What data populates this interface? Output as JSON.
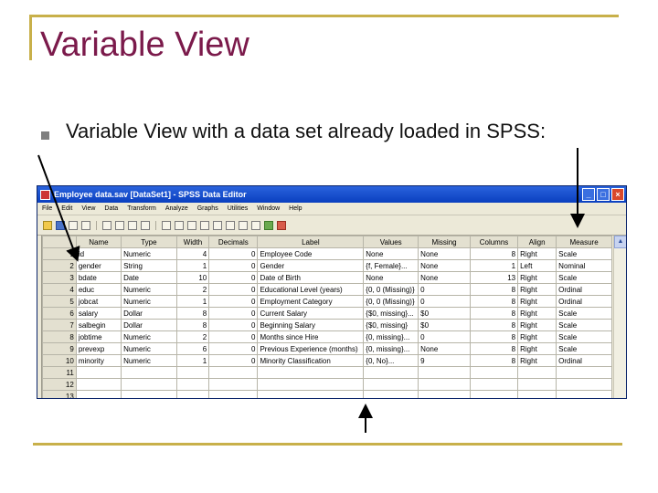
{
  "slide": {
    "title": "Variable View",
    "bullet": "Variable View with a data set already loaded in SPSS:"
  },
  "window": {
    "title": "Employee data.sav [DataSet1] - SPSS Data Editor",
    "controls": [
      "_",
      "□",
      "×"
    ],
    "menu": [
      "File",
      "Edit",
      "View",
      "Data",
      "Transform",
      "Analyze",
      "Graphs",
      "Utilities",
      "Window",
      "Help"
    ]
  },
  "grid": {
    "columns": [
      "",
      "Name",
      "Type",
      "Width",
      "Decimals",
      "Label",
      "Values",
      "Missing",
      "Columns",
      "Align",
      "Measure"
    ],
    "rows": [
      [
        "1",
        "id",
        "Numeric",
        "4",
        "0",
        "Employee Code",
        "None",
        "None",
        "8",
        "Right",
        "Scale"
      ],
      [
        "2",
        "gender",
        "String",
        "1",
        "0",
        "Gender",
        "{f, Female}...",
        "None",
        "1",
        "Left",
        "Nominal"
      ],
      [
        "3",
        "bdate",
        "Date",
        "10",
        "0",
        "Date of Birth",
        "None",
        "None",
        "13",
        "Right",
        "Scale"
      ],
      [
        "4",
        "educ",
        "Numeric",
        "2",
        "0",
        "Educational Level (years)",
        "{0, 0 (Missing)}",
        "0",
        "8",
        "Right",
        "Ordinal"
      ],
      [
        "5",
        "jobcat",
        "Numeric",
        "1",
        "0",
        "Employment Category",
        "{0, 0 (Missing)}",
        "0",
        "8",
        "Right",
        "Ordinal"
      ],
      [
        "6",
        "salary",
        "Dollar",
        "8",
        "0",
        "Current Salary",
        "{$0, missing}...",
        "$0",
        "8",
        "Right",
        "Scale"
      ],
      [
        "7",
        "salbegin",
        "Dollar",
        "8",
        "0",
        "Beginning Salary",
        "{$0, missing}",
        "$0",
        "8",
        "Right",
        "Scale"
      ],
      [
        "8",
        "jobtime",
        "Numeric",
        "2",
        "0",
        "Months since Hire",
        "{0, missing}...",
        "0",
        "8",
        "Right",
        "Scale"
      ],
      [
        "9",
        "prevexp",
        "Numeric",
        "6",
        "0",
        "Previous Experience (months)",
        "{0, missing}...",
        "None",
        "8",
        "Right",
        "Scale"
      ],
      [
        "10",
        "minority",
        "Numeric",
        "1",
        "0",
        "Minority Classification",
        "{0, No}...",
        "9",
        "8",
        "Right",
        "Ordinal"
      ],
      [
        "11",
        "",
        "",
        "",
        "",
        "",
        "",
        "",
        "",
        "",
        ""
      ],
      [
        "12",
        "",
        "",
        "",
        "",
        "",
        "",
        "",
        "",
        "",
        ""
      ],
      [
        "13",
        "",
        "",
        "",
        "",
        "",
        "",
        "",
        "",
        "",
        ""
      ]
    ]
  },
  "colors": {
    "title": "#7b1a4b",
    "frame": "#c8b04a",
    "titlebar": "#0a3fbf",
    "arrow": "#000000"
  }
}
